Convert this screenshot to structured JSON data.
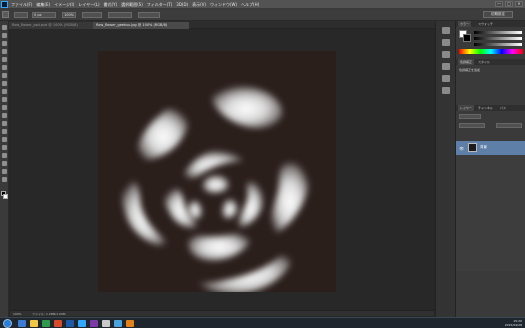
{
  "menubar": {
    "items": [
      "ファイル(F)",
      "編集(E)",
      "イメージ(I)",
      "レイヤー(L)",
      "書式(Y)",
      "選択範囲(S)",
      "フィルター(T)",
      "3D(D)",
      "表示(V)",
      "ウィンドウ(W)",
      "ヘルプ(H)"
    ],
    "window_buttons": [
      "—",
      "□",
      "✕"
    ]
  },
  "options": {
    "field_a": "0 px",
    "field_b": "100%",
    "workspace": "初期設定"
  },
  "tabs": [
    {
      "label": "flow_flower_psd.psd @ 100% (RGB/8)",
      "active": false
    },
    {
      "label": "flow_flower_geeksu.jpg @ 100% (RGB/8)",
      "active": true
    }
  ],
  "status": {
    "zoom": "100%",
    "doc": "ファイル: 1.28M/1.00M"
  },
  "panels": {
    "color_tabs": [
      "カラー",
      "スウォッチ"
    ],
    "adjust_tabs": [
      "色調補正",
      "スタイル"
    ],
    "adjust_label": "色調補正を追加",
    "layer_tabs": [
      "レイヤー",
      "チャンネル",
      "パス"
    ],
    "layer_name": "背景"
  },
  "taskbar": {
    "time": "15:20",
    "date": "2015/04/28"
  },
  "colors": {
    "accent": "#31a8ff",
    "canvas_bg": "#2b1f1c",
    "selected_layer": "#5d7fa8"
  }
}
